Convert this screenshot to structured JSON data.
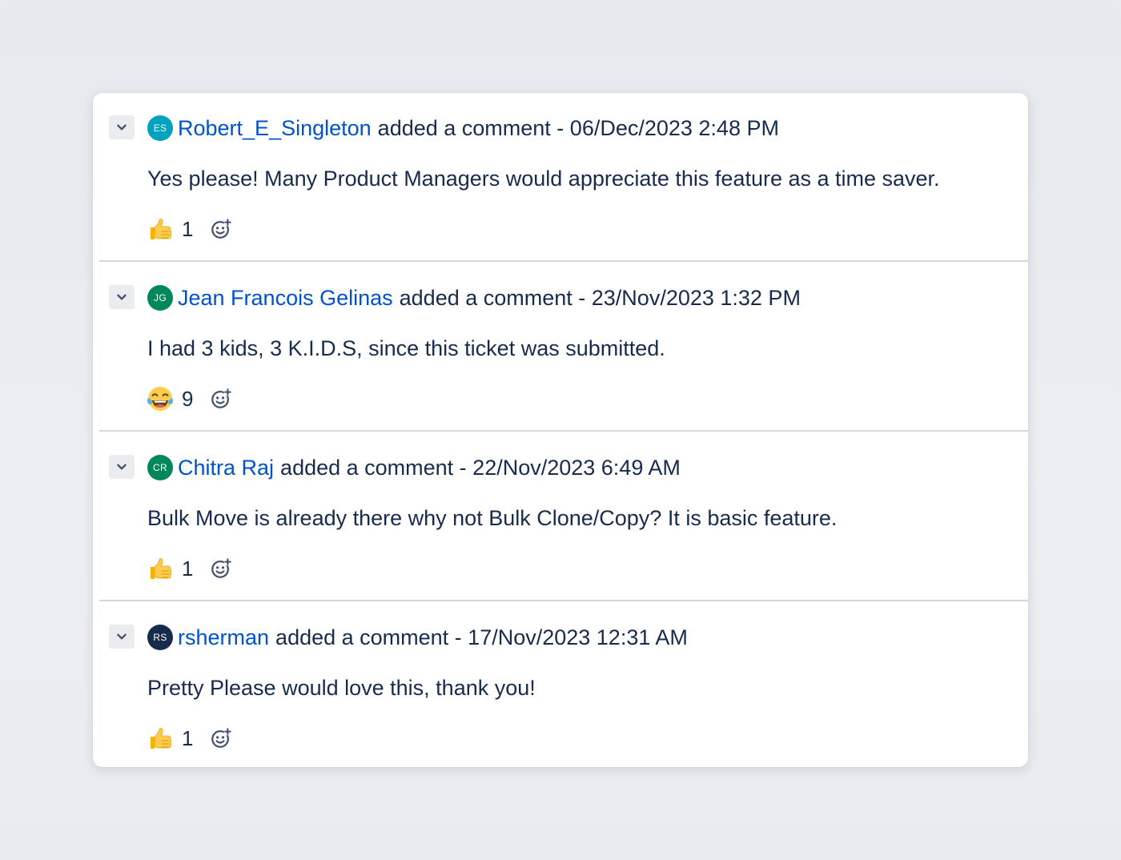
{
  "comments": [
    {
      "avatar_initials": "ES",
      "avatar_color": "#00a3bf",
      "author": "Robert_E_Singleton",
      "action": "added a comment - 06/Dec/2023 2:48 PM",
      "body": "Yes please! Many Product Managers would appreciate this feature as a time saver.",
      "reaction_emoji": "thumbs-up-icon",
      "reaction_count": "1"
    },
    {
      "avatar_initials": "JG",
      "avatar_color": "#00875a",
      "author": "Jean Francois Gelinas",
      "action": "added a comment - 23/Nov/2023 1:32 PM",
      "body": "I had 3 kids, 3 K.I.D.S, since this ticket was submitted.",
      "reaction_emoji": "tears-of-joy-icon",
      "reaction_count": "9"
    },
    {
      "avatar_initials": "CR",
      "avatar_color": "#00875a",
      "author": "Chitra Raj",
      "action": "added a comment - 22/Nov/2023 6:49 AM",
      "body": "Bulk Move is already there why not Bulk Clone/Copy? It is basic feature.",
      "reaction_emoji": "thumbs-up-icon",
      "reaction_count": "1"
    },
    {
      "avatar_initials": "RS",
      "avatar_color": "#172b4d",
      "author": "rsherman",
      "action": "added a comment - 17/Nov/2023 12:31 AM",
      "body": "Pretty Please would love this, thank you!",
      "reaction_emoji": "thumbs-up-icon",
      "reaction_count": "1"
    }
  ],
  "colors": {
    "link": "#0052cc",
    "text": "#172b4d",
    "divider": "#d3d6db"
  }
}
